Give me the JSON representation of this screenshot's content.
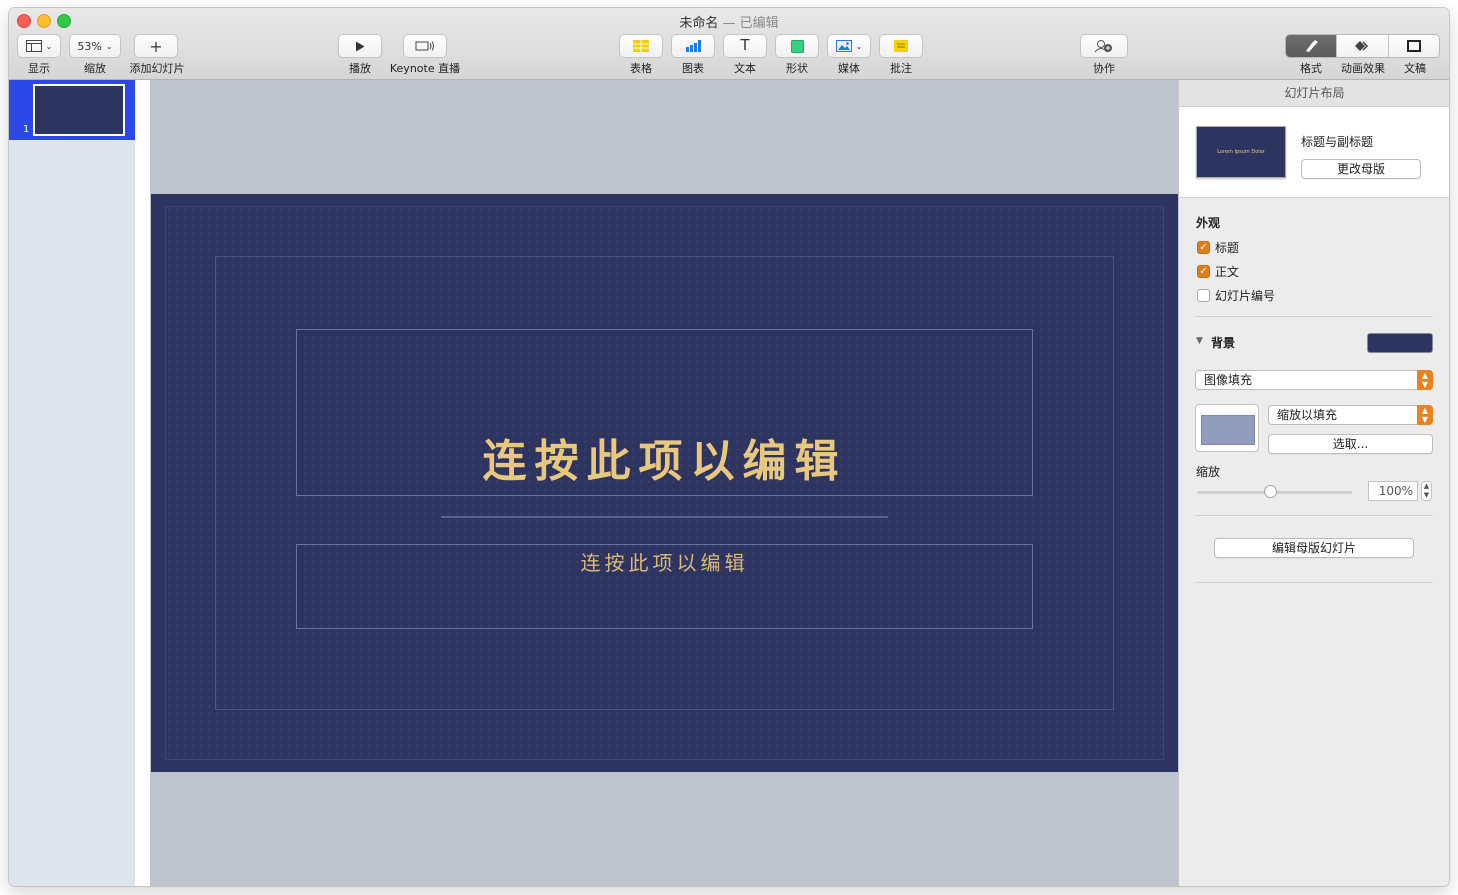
{
  "window": {
    "title": "未命名",
    "edited": "— 已编辑"
  },
  "toolbar": {
    "view_label": "显示",
    "zoom_value": "53%",
    "zoom_label": "缩放",
    "add_slide_label": "添加幻灯片",
    "play_label": "播放",
    "keynote_live_label": "Keynote 直播",
    "table_label": "表格",
    "chart_label": "图表",
    "text_label": "文本",
    "shape_label": "形状",
    "media_label": "媒体",
    "comment_label": "批注",
    "collaborate_label": "协作",
    "format_label": "格式",
    "animate_label": "动画效果",
    "document_label": "文稿"
  },
  "navigator": {
    "slides": [
      {
        "number": "1"
      }
    ]
  },
  "slide": {
    "title": "连按此项以编辑",
    "subtitle": "连按此项以编辑"
  },
  "inspector": {
    "header": "幻灯片布局",
    "layout_name": "标题与副标题",
    "layout_thumb_title": "Lorem Ipsum Dolor",
    "change_master_label": "更改母版",
    "appearance_label": "外观",
    "checkboxes": [
      {
        "label": "标题",
        "checked": true
      },
      {
        "label": "正文",
        "checked": true
      },
      {
        "label": "幻灯片编号",
        "checked": false
      }
    ],
    "background_label": "背景",
    "background_color": "#2e3460",
    "fill_type": "图像填充",
    "scale_mode": "缩放以填充",
    "choose_label": "选取...",
    "scale_label": "缩放",
    "scale_value": "100%",
    "edit_master_label": "编辑母版幻灯片"
  },
  "colors": {
    "accent": "#e8831f",
    "selection": "#2c47e8",
    "slide_bg": "#2e3460",
    "title_gold": "#e8c77f"
  }
}
